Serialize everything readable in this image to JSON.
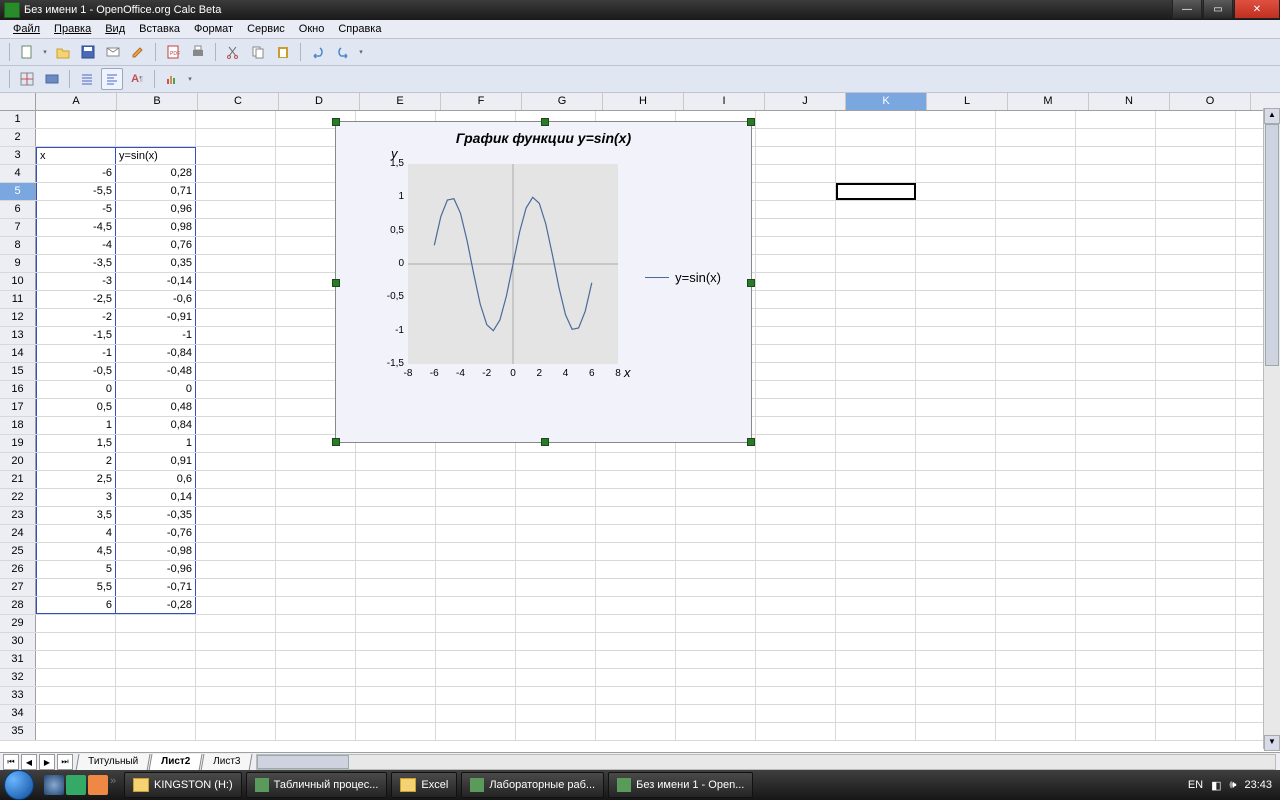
{
  "window": {
    "title": "Без имени 1 - OpenOffice.org Calc Beta"
  },
  "menu": {
    "file": "Файл",
    "edit": "Правка",
    "view": "Вид",
    "insert": "Вставка",
    "format": "Формат",
    "tools": "Сервис",
    "window": "Окно",
    "help": "Справка"
  },
  "columns": [
    "A",
    "B",
    "C",
    "D",
    "E",
    "F",
    "G",
    "H",
    "I",
    "J",
    "K",
    "L",
    "M",
    "N",
    "O"
  ],
  "selected_col": "K",
  "selected_row": 5,
  "active_cell": "K5",
  "data_headers": {
    "col_a": "x",
    "col_b": "y=sin(x)"
  },
  "table": [
    {
      "row": 4,
      "x": "-6",
      "y": "0,28"
    },
    {
      "row": 5,
      "x": "-5,5",
      "y": "0,71"
    },
    {
      "row": 6,
      "x": "-5",
      "y": "0,96"
    },
    {
      "row": 7,
      "x": "-4,5",
      "y": "0,98"
    },
    {
      "row": 8,
      "x": "-4",
      "y": "0,76"
    },
    {
      "row": 9,
      "x": "-3,5",
      "y": "0,35"
    },
    {
      "row": 10,
      "x": "-3",
      "y": "-0,14"
    },
    {
      "row": 11,
      "x": "-2,5",
      "y": "-0,6"
    },
    {
      "row": 12,
      "x": "-2",
      "y": "-0,91"
    },
    {
      "row": 13,
      "x": "-1,5",
      "y": "-1"
    },
    {
      "row": 14,
      "x": "-1",
      "y": "-0,84"
    },
    {
      "row": 15,
      "x": "-0,5",
      "y": "-0,48"
    },
    {
      "row": 16,
      "x": "0",
      "y": "0"
    },
    {
      "row": 17,
      "x": "0,5",
      "y": "0,48"
    },
    {
      "row": 18,
      "x": "1",
      "y": "0,84"
    },
    {
      "row": 19,
      "x": "1,5",
      "y": "1"
    },
    {
      "row": 20,
      "x": "2",
      "y": "0,91"
    },
    {
      "row": 21,
      "x": "2,5",
      "y": "0,6"
    },
    {
      "row": 22,
      "x": "3",
      "y": "0,14"
    },
    {
      "row": 23,
      "x": "3,5",
      "y": "-0,35"
    },
    {
      "row": 24,
      "x": "4",
      "y": "-0,76"
    },
    {
      "row": 25,
      "x": "4,5",
      "y": "-0,98"
    },
    {
      "row": 26,
      "x": "5",
      "y": "-0,96"
    },
    {
      "row": 27,
      "x": "5,5",
      "y": "-0,71"
    },
    {
      "row": 28,
      "x": "6",
      "y": "-0,28"
    }
  ],
  "visible_row_count": 35,
  "chart_data": {
    "type": "line",
    "title": "График функции y=sin(x)",
    "xlabel": "x",
    "ylabel": "y",
    "legend": "y=sin(x)",
    "xlim": [
      -8,
      8
    ],
    "ylim": [
      -1.5,
      1.5
    ],
    "xticks": [
      "-8",
      "-6",
      "-4",
      "-2",
      "0",
      "2",
      "4",
      "6",
      "8"
    ],
    "yticks": [
      "-1,5",
      "-1",
      "-0,5",
      "0",
      "0,5",
      "1",
      "1,5"
    ],
    "x": [
      -6,
      -5.5,
      -5,
      -4.5,
      -4,
      -3.5,
      -3,
      -2.5,
      -2,
      -1.5,
      -1,
      -0.5,
      0,
      0.5,
      1,
      1.5,
      2,
      2.5,
      3,
      3.5,
      4,
      4.5,
      5,
      5.5,
      6
    ],
    "y": [
      0.28,
      0.71,
      0.96,
      0.98,
      0.76,
      0.35,
      -0.14,
      -0.6,
      -0.91,
      -1,
      -0.84,
      -0.48,
      0,
      0.48,
      0.84,
      1,
      0.91,
      0.6,
      0.14,
      -0.35,
      -0.76,
      -0.98,
      -0.96,
      -0.71,
      -0.28
    ]
  },
  "sheets": {
    "navs": [
      "⏮",
      "◀",
      "▶",
      "⏭"
    ],
    "tabs": [
      {
        "name": "Титульный",
        "active": false
      },
      {
        "name": "Лист2",
        "active": true
      },
      {
        "name": "Лист3",
        "active": false
      }
    ]
  },
  "taskbar": {
    "items": [
      {
        "label": "KINGSTON (H:)",
        "icon": "folder"
      },
      {
        "label": "Табличный процес...",
        "icon": "doc"
      },
      {
        "label": "Excel",
        "icon": "folder"
      },
      {
        "label": "Лабораторные раб...",
        "icon": "doc"
      },
      {
        "label": "Без имени 1 - Open...",
        "icon": "calc"
      }
    ],
    "lang": "EN",
    "clock": "23:43"
  }
}
